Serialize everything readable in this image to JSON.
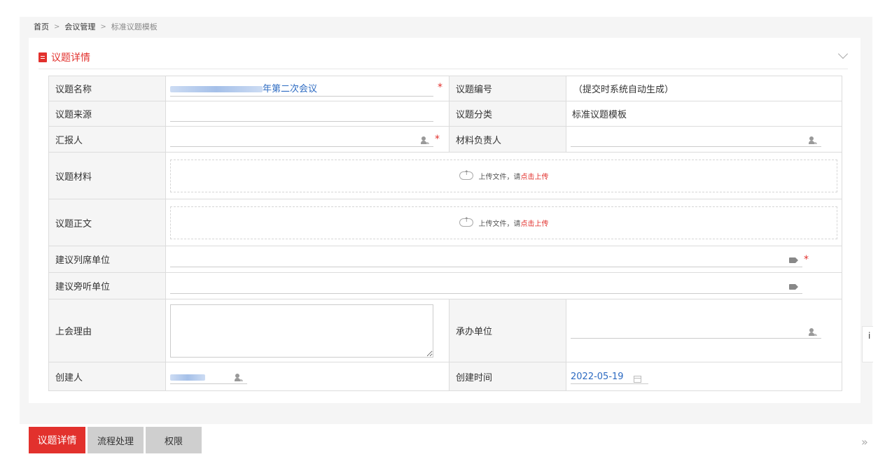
{
  "breadcrumb": {
    "home": "首页",
    "sep": ">",
    "meeting": "会议管理",
    "current": "标准议题模板"
  },
  "section": {
    "title": "议题详情"
  },
  "form": {
    "labels": {
      "topic_name": "议题名称",
      "topic_no": "议题编号",
      "topic_source": "议题来源",
      "topic_category": "议题分类",
      "reporter": "汇报人",
      "material_owner": "材料负责人",
      "materials": "议题材料",
      "body": "议题正文",
      "suggested_attendee": "建议列席单位",
      "suggested_observer": "建议旁听单位",
      "reason": "上会理由",
      "undertaker": "承办单位",
      "creator": "创建人",
      "created_time": "创建时间"
    },
    "values": {
      "topic_name_suffix": "年第二次会议",
      "topic_no": "（提交时系统自动生成）",
      "topic_category": "标准议题模板",
      "created_time": "2022-05-19"
    },
    "required_mark": "*",
    "upload": {
      "prefix": "上传文件，请 ",
      "link": "点击上传"
    }
  },
  "tabs": [
    {
      "label": "议题详情"
    },
    {
      "label": "流程处理"
    },
    {
      "label": "权限"
    }
  ],
  "icons": {
    "document": "doc-icon",
    "collapse": "chevron-down-icon",
    "person": "person-select-icon",
    "tag": "tag-icon",
    "upload": "cloud-upload-icon",
    "calendar": "calendar-icon",
    "expand": "double-chevron-right-icon"
  },
  "side_widget_text": "i",
  "colors": {
    "accent": "#e2312d",
    "link": "#2d6bc2",
    "label_bg": "#f5f5f5",
    "tab_inactive": "#cfcfcf"
  }
}
